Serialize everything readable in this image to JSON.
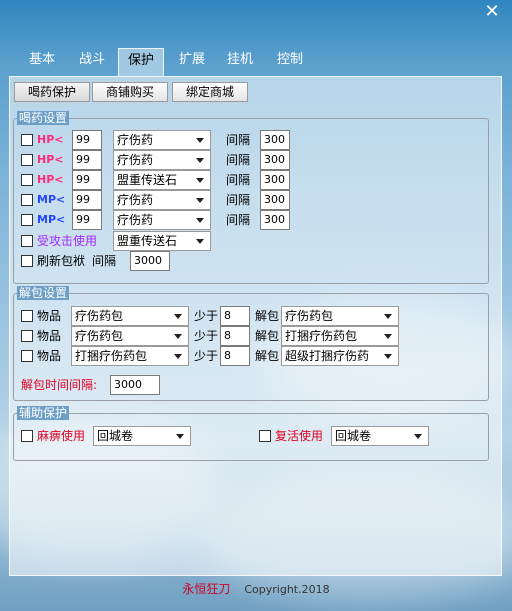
{
  "window": {
    "close_label": "✕"
  },
  "tabs": [
    "基本",
    "战斗",
    "保护",
    "扩展",
    "挂机",
    "控制"
  ],
  "subtabs": [
    "喝药保护",
    "商铺购买",
    "绑定商城"
  ],
  "drink_section": {
    "title": "喝药设置",
    "rows": [
      {
        "type": "HP",
        "arrow": "<",
        "value": "99",
        "item": "疗伤药",
        "interval_label": "间隔",
        "interval": "300"
      },
      {
        "type": "HP",
        "arrow": "<",
        "value": "99",
        "item": "疗伤药",
        "interval_label": "间隔",
        "interval": "300"
      },
      {
        "type": "HP",
        "arrow": "<",
        "value": "99",
        "item": "盟重传送石",
        "interval_label": "间隔",
        "interval": "300"
      },
      {
        "type": "MP",
        "arrow": "<",
        "value": "99",
        "item": "疗伤药",
        "interval_label": "间隔",
        "interval": "300"
      },
      {
        "type": "MP",
        "arrow": "<",
        "value": "99",
        "item": "疗伤药",
        "interval_label": "间隔",
        "interval": "300"
      }
    ],
    "attacked_label": "受攻击使用",
    "attacked_item": "盟重传送石",
    "refresh_label": "刷新包袱",
    "refresh_interval_label": "间隔",
    "refresh_interval": "3000"
  },
  "unpack_section": {
    "title": "解包设置",
    "rows": [
      {
        "item_label": "物品",
        "item": "疗伤药包",
        "less_label": "少于",
        "count": "8",
        "unpack_label": "解包",
        "result": "疗伤药包"
      },
      {
        "item_label": "物品",
        "item": "疗伤药包",
        "less_label": "少于",
        "count": "8",
        "unpack_label": "解包",
        "result": "打捆疗伤药包"
      },
      {
        "item_label": "物品",
        "item": "打捆疗伤药包",
        "less_label": "少于",
        "count": "8",
        "unpack_label": "解包",
        "result": "超级打捆疗伤药"
      }
    ],
    "interval_label": "解包时间间隔:",
    "interval": "3000"
  },
  "assist_section": {
    "title": "辅助保护",
    "paralysis_label": "麻痹使用",
    "paralysis_item": "回城卷",
    "revive_label": "复活使用",
    "revive_item": "回城卷"
  },
  "footer": {
    "left": "永恒狂刀",
    "right": "Copyright.2018"
  },
  "colors": {
    "hp": "#ff2a7a",
    "mp": "#2448ff",
    "attacked": "#a028ff",
    "assist": "#e00024"
  }
}
